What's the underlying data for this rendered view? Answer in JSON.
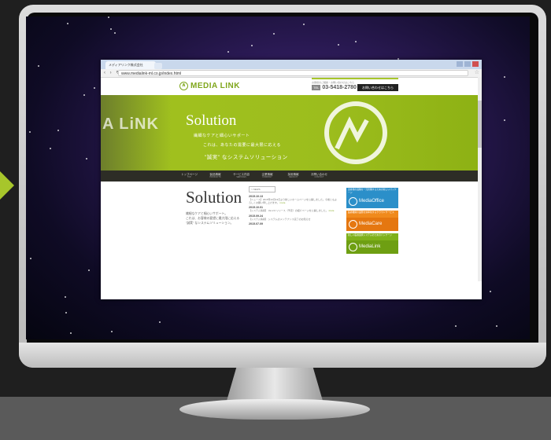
{
  "browser": {
    "tab_title": "メディアリンク株式会社",
    "url": "www.medialink-ml.co.jp/index.html"
  },
  "header": {
    "logo": "MEDIA LINK",
    "contact_note": "お客様のご相談・お問い合わせはこちら",
    "tel_badge": "TEL",
    "tel": "03-5418-2780",
    "contact_button": "お問い合わせはこちら"
  },
  "hero": {
    "bg_text": "A LiNK",
    "title": "Solution",
    "line1": "繊細なケアと細心いサポート",
    "line2": "これは、あなたの需要に最大限に応える",
    "line3": "\"誠実\" なシステムソリューション"
  },
  "nav": [
    {
      "label": "トップページ",
      "sub": "TOP"
    },
    {
      "label": "製品情報",
      "sub": "PRODUCTS"
    },
    {
      "label": "サービス内容",
      "sub": "SERVICES"
    },
    {
      "label": "企業情報",
      "sub": "COMPANY"
    },
    {
      "label": "採用情報",
      "sub": "RECRUIT"
    },
    {
      "label": "お問い合わせ",
      "sub": "CONTACT"
    }
  ],
  "content": {
    "title": "Solution",
    "text1": "繊細なケアと細心いサポート。",
    "text2": "これは、お客様の要望に最大限に応える",
    "text3": "\"誠実\" なシステムソリューション。"
  },
  "news": {
    "heading": "> NEWS",
    "items": [
      {
        "date": "2015.10.13",
        "body": "【ニュース】2015年10月13日より新しいホームページを公開しました。今後ともよろしくお願い申し上げます。",
        "more": "more"
      },
      {
        "date": "2015.10.01",
        "body": "【システム情報】 Ver.2.0 リリース（予定）の紹介ページを公開しました。",
        "more": "more"
      },
      {
        "date": "2015.09.24",
        "body": "【システム情報】 システムのメンテナンス完了のお知らせ",
        "more": ""
      },
      {
        "date": "2015.07.09",
        "body": "",
        "more": ""
      }
    ]
  },
  "banners": [
    {
      "top": "患者様の画像を一元管理するための新しいパッケージ",
      "name": "MediaOffice"
    },
    {
      "top": "医療機関の業務を効率化するクラウドサービス",
      "name": "MediaCare"
    },
    {
      "top": "新しい医療連携システムのためのパッケージ",
      "name": "MediaLink"
    }
  ],
  "colors": {
    "accent": "#a2c21f",
    "nav_bg": "#2d2d26"
  }
}
